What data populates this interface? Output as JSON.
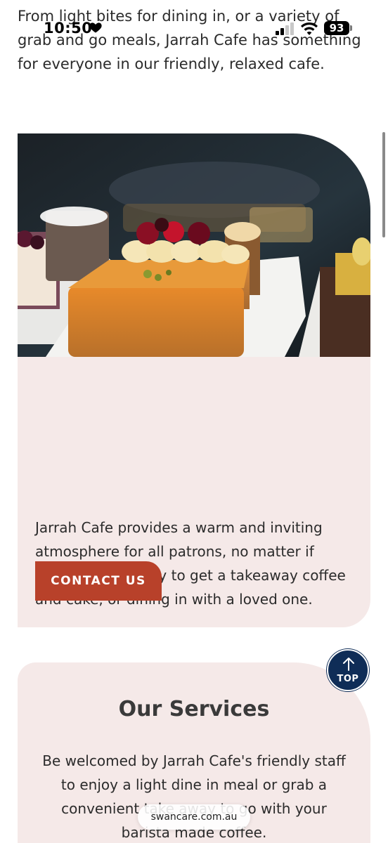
{
  "status_bar": {
    "time": "10:50",
    "battery": "93"
  },
  "intro": {
    "text": "From light bites for dining in, or a variety of grab and go meals, Jarrah Cafe has something for everyone in our friendly, relaxed cafe."
  },
  "card": {
    "text": "Jarrah Cafe provides a warm and inviting atmosphere for all patrons, no matter if you’re stopping by to get a takeaway coffee and cake, or dining in with a loved one.",
    "button_label": "CONTACT US"
  },
  "services": {
    "title": "Our Services",
    "text": "Be welcomed by Jarrah Cafe's friendly staff to enjoy a light dine in meal or grab a convenient take away to go with your barista made coffee."
  },
  "top_button": {
    "label": "TOP"
  },
  "browser": {
    "url": "swancare.com.au"
  },
  "colors": {
    "accent": "#b8412a",
    "card_bg": "#f5e9e8",
    "top_button": "#0f2d57"
  }
}
